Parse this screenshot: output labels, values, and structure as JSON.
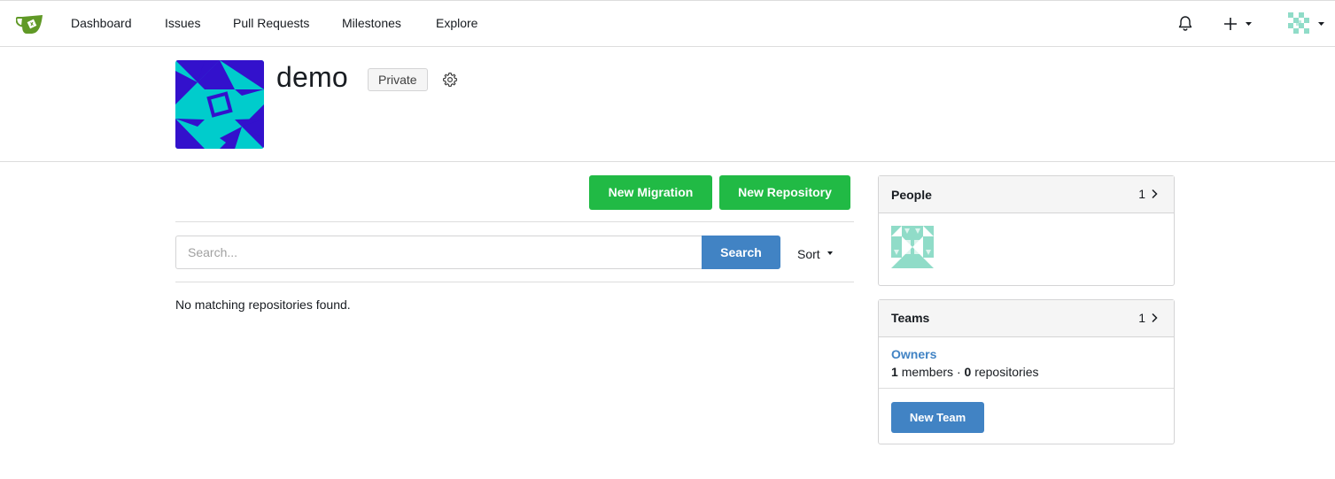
{
  "nav": {
    "items": [
      {
        "label": "Dashboard"
      },
      {
        "label": "Issues"
      },
      {
        "label": "Pull Requests"
      },
      {
        "label": "Milestones"
      },
      {
        "label": "Explore"
      }
    ],
    "logo_icon": "gitea-teacup-icon",
    "notification_icon": "bell-icon",
    "create_icon": "plus-icon",
    "user_avatar_icon": "identicon-avatar"
  },
  "org": {
    "name": "demo",
    "visibility_badge": "Private",
    "settings_icon": "gear-icon",
    "avatar_colors": {
      "background": "#00cccc",
      "shapes": "#3311cc"
    }
  },
  "actions": {
    "new_migration": "New Migration",
    "new_repository": "New Repository"
  },
  "search": {
    "placeholder": "Search...",
    "value": "",
    "button": "Search",
    "sort_label": "Sort"
  },
  "repo_list": {
    "empty_message": "No matching repositories found."
  },
  "people": {
    "title": "People",
    "count": "1"
  },
  "teams": {
    "title": "Teams",
    "count": "1",
    "items": [
      {
        "name": "Owners",
        "members_count": "1",
        "members_label": "members",
        "separator": "·",
        "repos_count": "0",
        "repos_label": "repositories"
      }
    ],
    "new_team": "New Team"
  },
  "colors": {
    "green": "#21ba45",
    "blue": "#4183c4",
    "border": "#d4d4d5",
    "identicon": "#90dcc8"
  }
}
